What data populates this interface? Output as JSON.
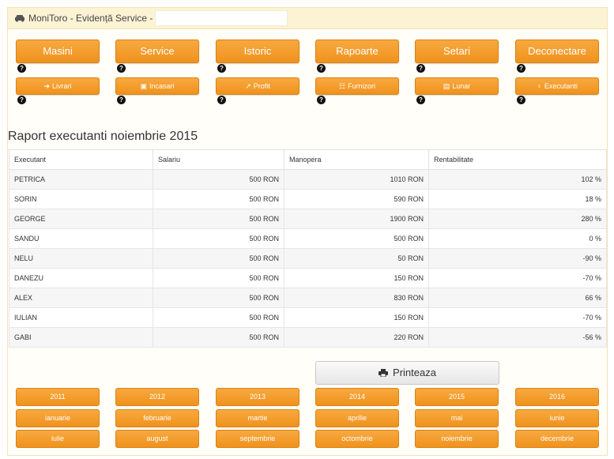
{
  "header": {
    "title": "MoniToro - Evidență Service -"
  },
  "nav_main": [
    "Masini",
    "Service",
    "Istoric",
    "Rapoarte",
    "Setari",
    "Deconectare"
  ],
  "nav_sub": [
    {
      "label": "Livrari",
      "icon": "truck-icon"
    },
    {
      "label": "Incasari",
      "icon": "money-icon"
    },
    {
      "label": "Profit",
      "icon": "chart-icon"
    },
    {
      "label": "Furnizori",
      "icon": "sitemap-icon"
    },
    {
      "label": "Lunar",
      "icon": "calendar-icon"
    },
    {
      "label": "Executanti",
      "icon": "person-icon"
    }
  ],
  "help_label": "?",
  "report": {
    "title": "Raport executanti noiembrie 2015",
    "columns": [
      "Executant",
      "Salariu",
      "Manopera",
      "Rentabilitate"
    ],
    "rows": [
      [
        "PETRICA",
        "500 RON",
        "1010 RON",
        "102 %"
      ],
      [
        "SORIN",
        "500 RON",
        "590 RON",
        "18 %"
      ],
      [
        "GEORGE",
        "500 RON",
        "1900 RON",
        "280 %"
      ],
      [
        "SANDU",
        "500 RON",
        "500 RON",
        "0 %"
      ],
      [
        "NELU",
        "500 RON",
        "50 RON",
        "-90 %"
      ],
      [
        "DANEZU",
        "500 RON",
        "150 RON",
        "-70 %"
      ],
      [
        "ALEX",
        "500 RON",
        "830 RON",
        "66 %"
      ],
      [
        "IULIAN",
        "500 RON",
        "150 RON",
        "-70 %"
      ],
      [
        "GABI",
        "500 RON",
        "220 RON",
        "-56 %"
      ]
    ]
  },
  "print_label": "Printeaza",
  "years": [
    "2011",
    "2012",
    "2013",
    "2014",
    "2015",
    "2016"
  ],
  "months": [
    "ianuarie",
    "februarie",
    "martie",
    "aprilie",
    "mai",
    "iunie",
    "iulie",
    "august",
    "septembrie",
    "octombrie",
    "noiembrie",
    "decembrie"
  ]
}
